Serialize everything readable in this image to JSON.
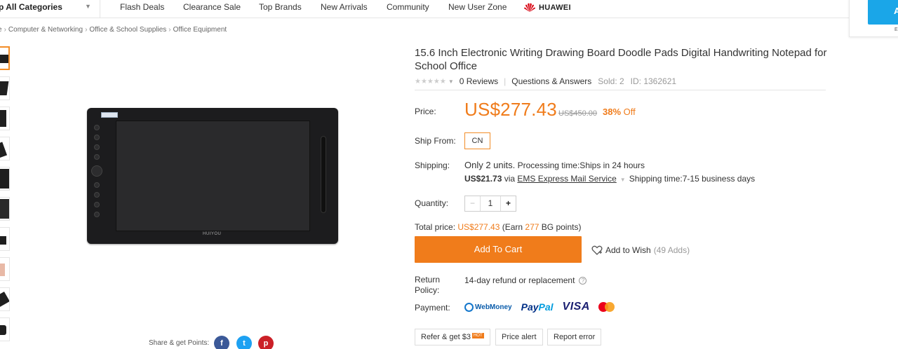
{
  "nav": {
    "all_categories": "p All Categories",
    "links": [
      "Flash Deals",
      "Clearance Sale",
      "Top Brands",
      "New Arrivals",
      "Community",
      "New User Zone"
    ],
    "brand": "HUAWEI",
    "corner_button": "A",
    "corner_mini": "E"
  },
  "breadcrumb": [
    "e",
    "Computer & Networking",
    "Office & School Supplies",
    "Office Equipment"
  ],
  "product": {
    "image_logo": "HUIYOU",
    "title": "15.6 Inch Electronic Writing Drawing Board Doodle Pads Digital Handwriting Notepad for School Office",
    "reviews": "0 Reviews",
    "qa": "Questions & Answers",
    "sold": "Sold: 2",
    "id": "ID: 1362621",
    "stars": "★★★★★"
  },
  "price": {
    "label": "Price:",
    "current": "US$277.43",
    "original": "US$450.00",
    "off_pct": "38%",
    "off_word": " Off"
  },
  "ship_from": {
    "label": "Ship From:",
    "value": "CN"
  },
  "shipping": {
    "label": "Shipping:",
    "units": "Only 2 units.",
    "processing": "Processing time:Ships in 24 hours",
    "cost": "US$21.73",
    "via": "via",
    "method": "EMS Express Mail Service",
    "time": "Shipping time:7-15 business days"
  },
  "quantity": {
    "label": "Quantity:",
    "minus": "−",
    "value": "1",
    "plus": "+"
  },
  "total": {
    "prefix": "Total price: ",
    "amount": "US$277.43",
    "earn_prefix": " (Earn ",
    "points": "277",
    "earn_suffix": " BG points)"
  },
  "actions": {
    "add_to_cart": "Add To Cart",
    "add_to_wish": "Add to Wish",
    "wish_count": "(49 Adds)"
  },
  "return_policy": {
    "label": "Return Policy:",
    "value": "14-day refund or replacement",
    "help": "?"
  },
  "payment": {
    "label": "Payment:",
    "methods": [
      "WebMoney",
      "PayPal",
      "VISA",
      "MasterCard"
    ],
    "webmoney": "WebMoney",
    "paypal_a": "Pay",
    "paypal_b": "Pal",
    "visa": "VISA"
  },
  "bottom_buttons": {
    "refer": "Refer & get $3",
    "hot": "HOT",
    "price_alert": "Price alert",
    "report_error": "Report error"
  },
  "share": {
    "label": "Share & get Points:",
    "fb": "f",
    "tw": "t",
    "pin": "p"
  },
  "colors": {
    "accent": "#f07c1b",
    "corner_button": "#1aa6e8"
  }
}
